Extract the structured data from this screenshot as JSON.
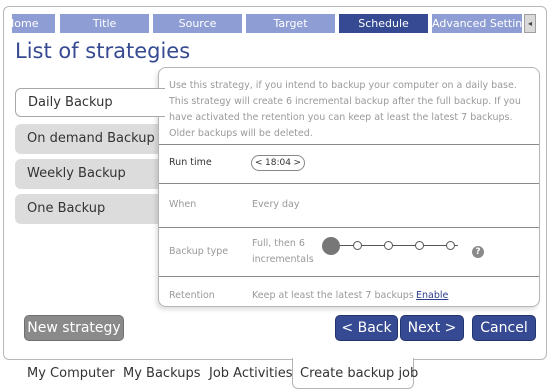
{
  "wizard_tabs": [
    {
      "label": "Home"
    },
    {
      "label": "Title"
    },
    {
      "label": "Source"
    },
    {
      "label": "Target"
    },
    {
      "label": "Schedule"
    },
    {
      "label": "Advanced Settings"
    }
  ],
  "page_title": "List of strategies",
  "strategies": [
    {
      "label": "Daily Backup"
    },
    {
      "label": "On demand Backup"
    },
    {
      "label": "Weekly Backup"
    },
    {
      "label": "One Backup"
    }
  ],
  "details": {
    "description": "Use this strategy, if you intend to backup your computer on a daily base. This strategy will create 6 incremental backup after the full backup. If you have activated the retention you can keep at least the latest 7 backups. Older backups will be deleted.",
    "run_time_label": "Run time",
    "run_time_value": "18:04",
    "spinner_prev": "<",
    "spinner_next": ">",
    "when_label": "When",
    "when_value": "Every day",
    "backup_type_label": "Backup type",
    "backup_type_value_line1": "Full, then 6",
    "backup_type_value_line2": "incrementals",
    "backup_type_slider_position": 0,
    "backup_type_slider_steps": 5,
    "help_glyph": "?",
    "retention_label": "Retention",
    "retention_value": "Keep at least the latest 7 backups",
    "enable_link": "Enable"
  },
  "buttons": {
    "new_strategy": "New strategy",
    "back": "< Back",
    "next": "Next >",
    "cancel": "Cancel"
  },
  "bottom_tabs": [
    {
      "label": "My Computer"
    },
    {
      "label": "My Backups"
    },
    {
      "label": "Job Activities"
    },
    {
      "label": "Create backup job"
    }
  ],
  "tab_scroll_glyph": "◂",
  "colors": {
    "accent": "#354a93",
    "tab_inactive": "#8e9ed4",
    "strategy_bg": "#dcdcdc",
    "secondary_button": "#8a8a8a"
  }
}
